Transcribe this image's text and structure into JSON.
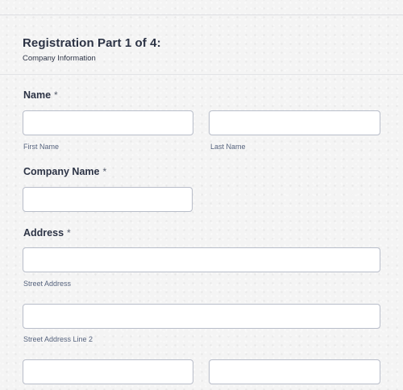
{
  "header": {
    "title": "Registration Part 1 of 4:",
    "subtitle": "Company Information"
  },
  "fields": {
    "name": {
      "label": "Name",
      "required_mark": "*",
      "first_value": "",
      "first_sublabel": "First Name",
      "last_value": "",
      "last_sublabel": "Last Name"
    },
    "company_name": {
      "label": "Company Name",
      "required_mark": "*",
      "value": ""
    },
    "address": {
      "label": "Address",
      "required_mark": "*",
      "street_value": "",
      "street_sublabel": "Street Address",
      "street2_value": "",
      "street2_sublabel": "Street Address Line 2",
      "city_value": "",
      "state_value": ""
    }
  }
}
